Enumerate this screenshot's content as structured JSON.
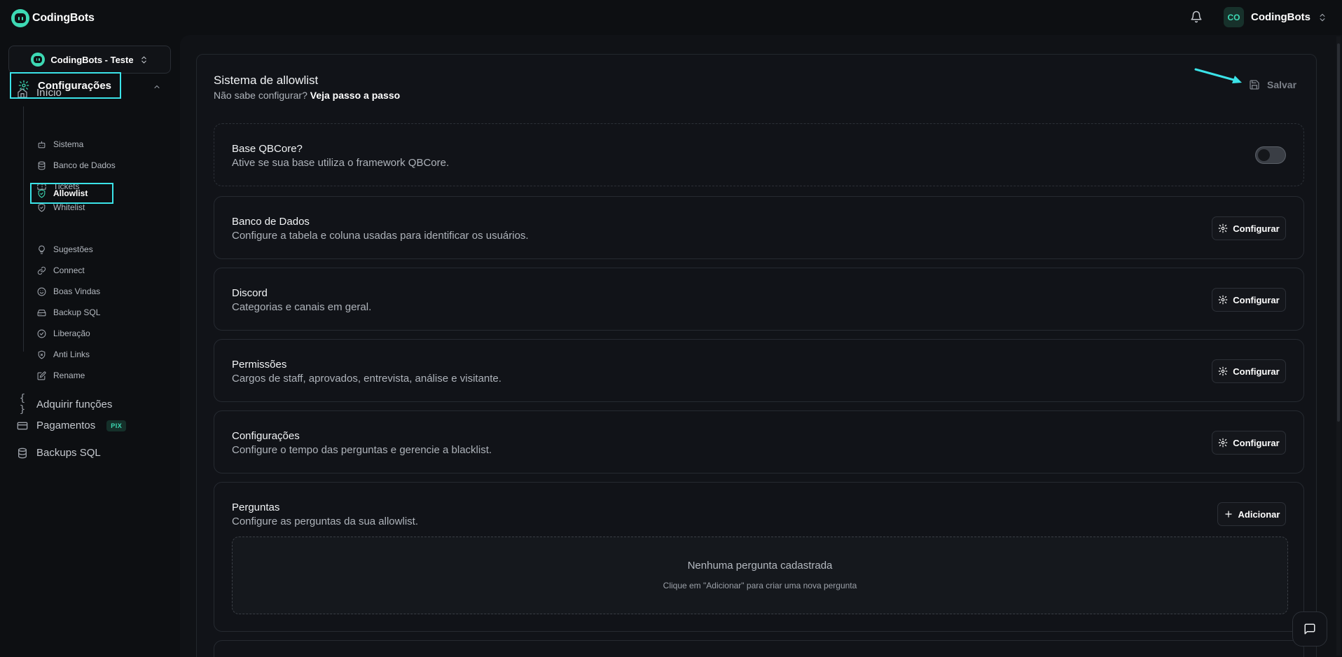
{
  "app": {
    "brand": "CodingBots",
    "user": {
      "initials": "CO",
      "name": "CodingBots"
    }
  },
  "sidebar": {
    "workspace": "CodingBots - Teste",
    "items": [
      {
        "label": "Início",
        "icon": "home-icon"
      },
      {
        "label": "Configurações",
        "icon": "gear-icon",
        "active": true,
        "expanded": true
      },
      {
        "label": "Adquirir funções",
        "icon": "braces-icon"
      },
      {
        "label": "Pagamentos",
        "icon": "card-icon",
        "badge": "PIX"
      },
      {
        "label": "Backups SQL",
        "icon": "database-icon"
      }
    ],
    "sub_items": [
      {
        "label": "Sistema",
        "icon": "bot-icon"
      },
      {
        "label": "Banco de Dados",
        "icon": "database-icon"
      },
      {
        "label": "Tickets",
        "icon": "ticket-icon"
      },
      {
        "label": "Whitelist",
        "icon": "shield-icon"
      },
      {
        "label": "Allowlist",
        "icon": "shield-check-icon",
        "active": true
      },
      {
        "label": "Sugestões",
        "icon": "lightbulb-icon"
      },
      {
        "label": "Connect",
        "icon": "link-icon"
      },
      {
        "label": "Boas Vindas",
        "icon": "smile-icon"
      },
      {
        "label": "Backup SQL",
        "icon": "drive-icon"
      },
      {
        "label": "Liberação",
        "icon": "check-circle-icon"
      },
      {
        "label": "Anti Links",
        "icon": "shield-x-icon"
      },
      {
        "label": "Rename",
        "icon": "edit-icon"
      }
    ]
  },
  "page": {
    "title": "Sistema de allowlist",
    "subtitle": "Não sabe configurar?",
    "subtitle_link": "Veja passo a passo",
    "save_label": "Salvar"
  },
  "cards": {
    "qbcore": {
      "title": "Base QBCore?",
      "desc": "Ative se sua base utiliza o framework QBCore.",
      "enabled": false
    },
    "database": {
      "title": "Banco de Dados",
      "desc": "Configure a tabela e coluna usadas para identificar os usuários.",
      "button": "Configurar"
    },
    "discord": {
      "title": "Discord",
      "desc": "Categorias e canais em geral.",
      "button": "Configurar"
    },
    "permissions": {
      "title": "Permissões",
      "desc": "Cargos de staff, aprovados, entrevista, análise e visitante.",
      "button": "Configurar"
    },
    "settings": {
      "title": "Configurações",
      "desc": "Configure o tempo das perguntas e gerencie a blacklist.",
      "button": "Configurar"
    },
    "questions": {
      "title": "Perguntas",
      "desc": "Configure as perguntas da sua allowlist.",
      "button": "Adicionar",
      "empty_title": "Nenhuma pergunta cadastrada",
      "empty_desc": "Clique em \"Adicionar\" para criar uma nova pergunta"
    }
  },
  "colors": {
    "accent": "#3dd9b4",
    "highlight": "#3be3e8",
    "background": "#0d0f12"
  }
}
